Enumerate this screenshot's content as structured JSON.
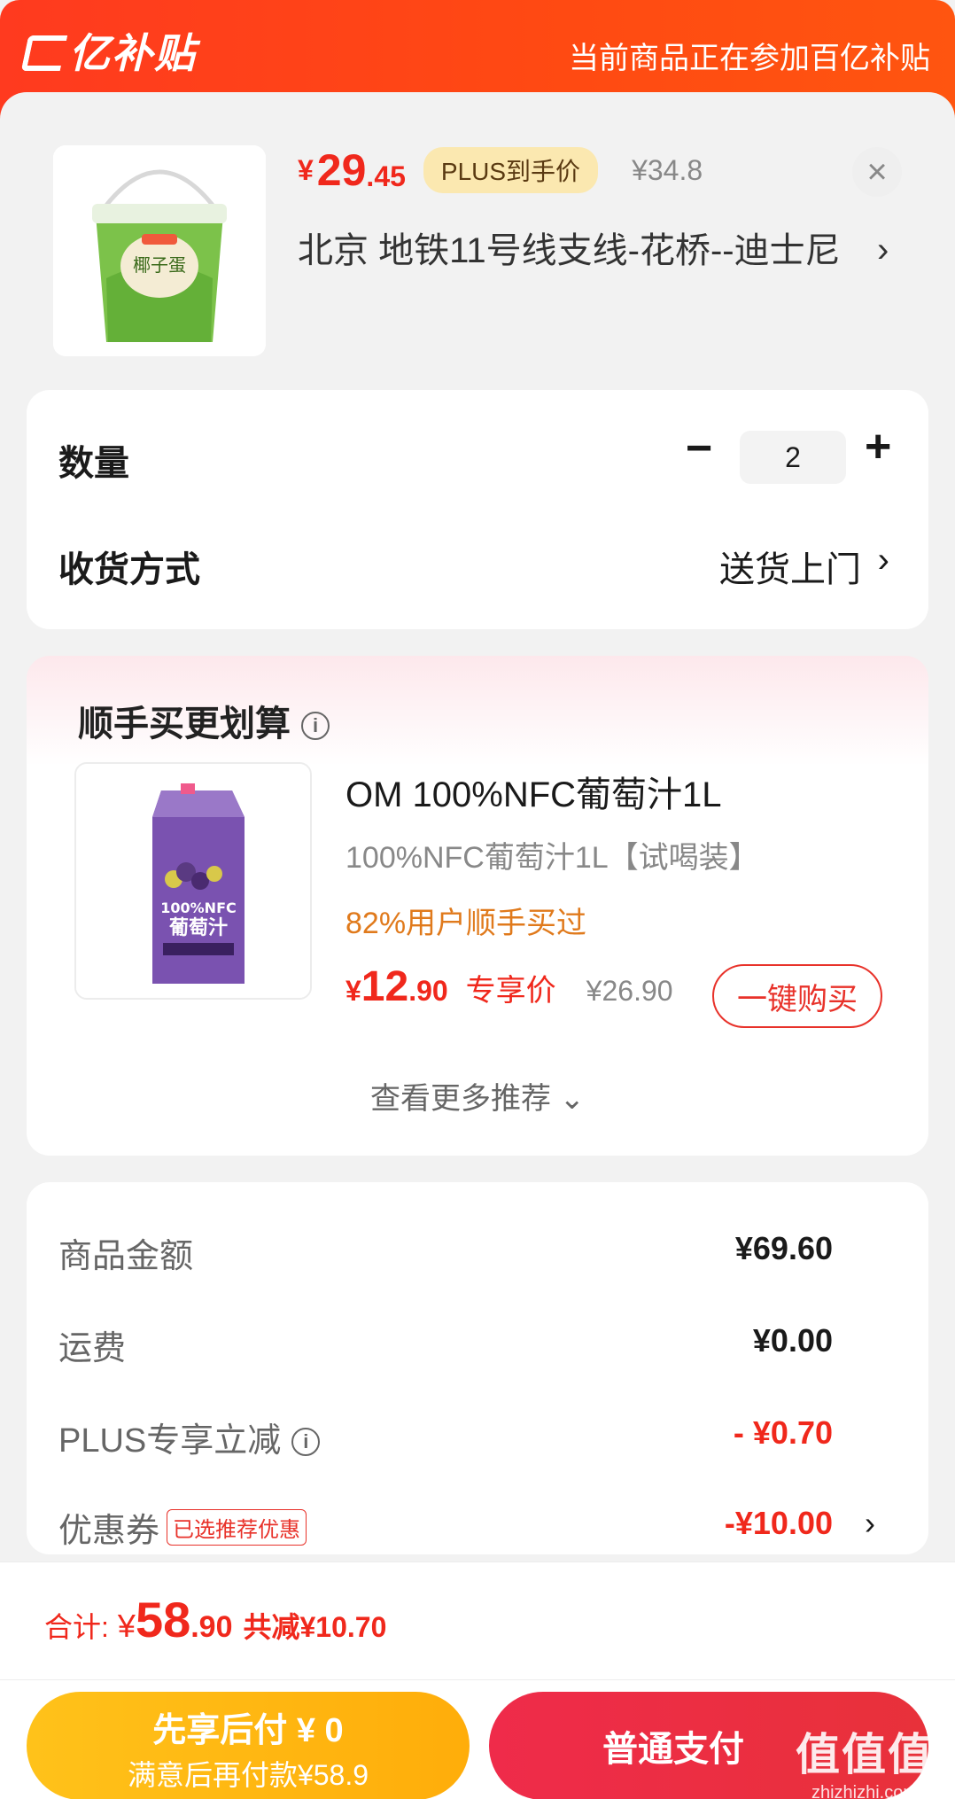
{
  "banner": {
    "logo_text": "亿补贴",
    "right_text": "当前商品正在参加百亿补贴"
  },
  "product": {
    "price_yen": "¥",
    "price_int": "29",
    "price_dec": ".45",
    "plus_badge": "PLUS到手价",
    "original_price": "¥34.8",
    "address": "北京  地铁11号线支线-花桥--迪士尼",
    "address_arrow": "›",
    "close_icon": "×",
    "image_label": "椰子蛋"
  },
  "quantity": {
    "label": "数量",
    "minus": "−",
    "value": "2",
    "plus": "+"
  },
  "delivery": {
    "label": "收货方式",
    "value": "送货上门",
    "arrow": "›"
  },
  "recommend": {
    "title": "顺手买更划算",
    "info_icon": "i",
    "item": {
      "name": "OM 100%NFC葡萄汁1L",
      "subtitle": "100%NFC葡萄汁1L【试喝装】",
      "social": "82%用户顺手买过",
      "price_yen": "¥",
      "price_int": "12",
      "price_dec": ".90",
      "price_tag": "专享价",
      "original_price": "¥26.90",
      "buy_label": "一键购买",
      "image_label_1": "100%NFC",
      "image_label_2": "葡萄汁"
    },
    "more_label": "查看更多推荐 ⌄"
  },
  "summary": {
    "rows": [
      {
        "label": "商品金额",
        "value": "¥69.60"
      },
      {
        "label": "运费",
        "value": "¥0.00"
      },
      {
        "label": "PLUS专享立减",
        "value": "- ¥0.70"
      },
      {
        "label": "优惠券",
        "value": "-¥10.00"
      }
    ],
    "coupon_tag": "已选推荐优惠",
    "coupon_arrow": "›"
  },
  "footer": {
    "total_label": "合计:",
    "total_yen": "¥",
    "total_int": "58",
    "total_dec": ".90",
    "total_discount": "共减¥10.70",
    "pay_later_line1": "先享后付 ¥ 0",
    "pay_later_line2": "满意后再付款¥58.9",
    "pay_button": "普通支付"
  },
  "watermark": {
    "line1": "值值值",
    "line2": "zhizhizhi.com"
  },
  "colors": {
    "banner": "#ff4a12",
    "price_red": "#f0281c",
    "plus_badge_bg": "#fbe8b0",
    "pay_later_bg": "#ffb812",
    "pay_bg": "#ea2d42",
    "social_orange": "#e07a1c"
  }
}
